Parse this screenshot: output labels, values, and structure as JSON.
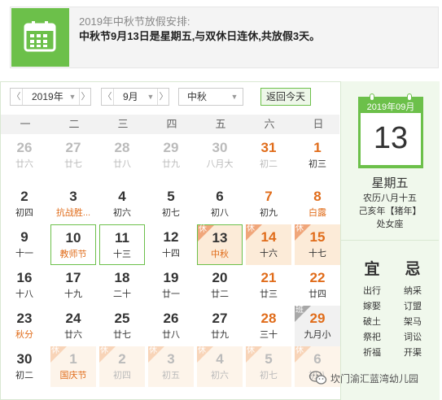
{
  "notice": {
    "title": "2019年中秋节放假安排:",
    "text": "中秋节9月13日是星期五,与双休日连休,共放假3天。",
    "icon": "calendar-icon"
  },
  "toolbar": {
    "year": "2019年",
    "month": "9月",
    "holiday": "中秋",
    "today_button": "返回今天",
    "prev_arrow": "〈",
    "next_arrow": "〉",
    "dropdown_arrow": "▼"
  },
  "weekdays": [
    "一",
    "二",
    "三",
    "四",
    "五",
    "六",
    "日"
  ],
  "rest_tag": "休",
  "work_tag": "班",
  "weeks": [
    [
      {
        "d": "26",
        "l": "廿六",
        "other": true
      },
      {
        "d": "27",
        "l": "廿七",
        "other": true
      },
      {
        "d": "28",
        "l": "廿八",
        "other": true
      },
      {
        "d": "29",
        "l": "廿九",
        "other": true
      },
      {
        "d": "30",
        "l": "八月大",
        "other": true
      },
      {
        "d": "31",
        "l": "初二",
        "other": true,
        "wkend": true
      },
      {
        "d": "1",
        "l": "初三",
        "wkend": true
      }
    ],
    [
      {
        "d": "2",
        "l": "初四"
      },
      {
        "d": "3",
        "l": "抗战胜...",
        "festival": true
      },
      {
        "d": "4",
        "l": "初六"
      },
      {
        "d": "5",
        "l": "初七"
      },
      {
        "d": "6",
        "l": "初八"
      },
      {
        "d": "7",
        "l": "初九",
        "wkend": true
      },
      {
        "d": "8",
        "l": "白露",
        "wkend": true,
        "festival": true
      }
    ],
    [
      {
        "d": "9",
        "l": "十一"
      },
      {
        "d": "10",
        "l": "教师节",
        "festival": true,
        "boxed": true
      },
      {
        "d": "11",
        "l": "十三",
        "boxed": true
      },
      {
        "d": "12",
        "l": "十四"
      },
      {
        "d": "13",
        "l": "中秋",
        "festival": true,
        "today": true,
        "rest": true
      },
      {
        "d": "14",
        "l": "十六",
        "wkend": true,
        "rest": true
      },
      {
        "d": "15",
        "l": "十七",
        "wkend": true,
        "rest": true
      }
    ],
    [
      {
        "d": "16",
        "l": "十八"
      },
      {
        "d": "17",
        "l": "十九"
      },
      {
        "d": "18",
        "l": "二十"
      },
      {
        "d": "19",
        "l": "廿一"
      },
      {
        "d": "20",
        "l": "廿二"
      },
      {
        "d": "21",
        "l": "廿三",
        "wkend": true
      },
      {
        "d": "22",
        "l": "廿四",
        "wkend": true
      }
    ],
    [
      {
        "d": "23",
        "l": "秋分",
        "festival": true
      },
      {
        "d": "24",
        "l": "廿六"
      },
      {
        "d": "25",
        "l": "廿七"
      },
      {
        "d": "26",
        "l": "廿八"
      },
      {
        "d": "27",
        "l": "廿九"
      },
      {
        "d": "28",
        "l": "三十",
        "wkend": true
      },
      {
        "d": "29",
        "l": "九月小",
        "wkend": true,
        "work": true
      }
    ],
    [
      {
        "d": "30",
        "l": "初二"
      },
      {
        "d": "1",
        "l": "国庆节",
        "other": true,
        "rest": true,
        "festival": true
      },
      {
        "d": "2",
        "l": "初四",
        "other": true,
        "rest": true
      },
      {
        "d": "3",
        "l": "初五",
        "other": true,
        "rest": true
      },
      {
        "d": "4",
        "l": "初六",
        "other": true,
        "rest": true
      },
      {
        "d": "5",
        "l": "初七",
        "other": true,
        "rest": true
      },
      {
        "d": "6",
        "l": "初八",
        "other": true,
        "rest": true
      }
    ]
  ],
  "side": {
    "year_month": "2019年09月",
    "day": "13",
    "weekday": "星期五",
    "lunar": "农历八月十五",
    "ganzhi": "己亥年【猪年】",
    "xingxiu": "处女座",
    "yi_title": "宜",
    "ji_title": "忌",
    "yi": [
      "出行",
      "嫁娶",
      "破土",
      "祭祀",
      "祈福"
    ],
    "ji": [
      "纳采",
      "订盟",
      "架马",
      "词讼",
      "开渠"
    ]
  },
  "watermark": {
    "text": "坎门渝汇蓝湾幼儿园",
    "icon": "wechat-icon"
  },
  "colors": {
    "accent": "#6cc04a",
    "weekend": "#e06c1a",
    "rest_bg": "#fcebd8"
  }
}
